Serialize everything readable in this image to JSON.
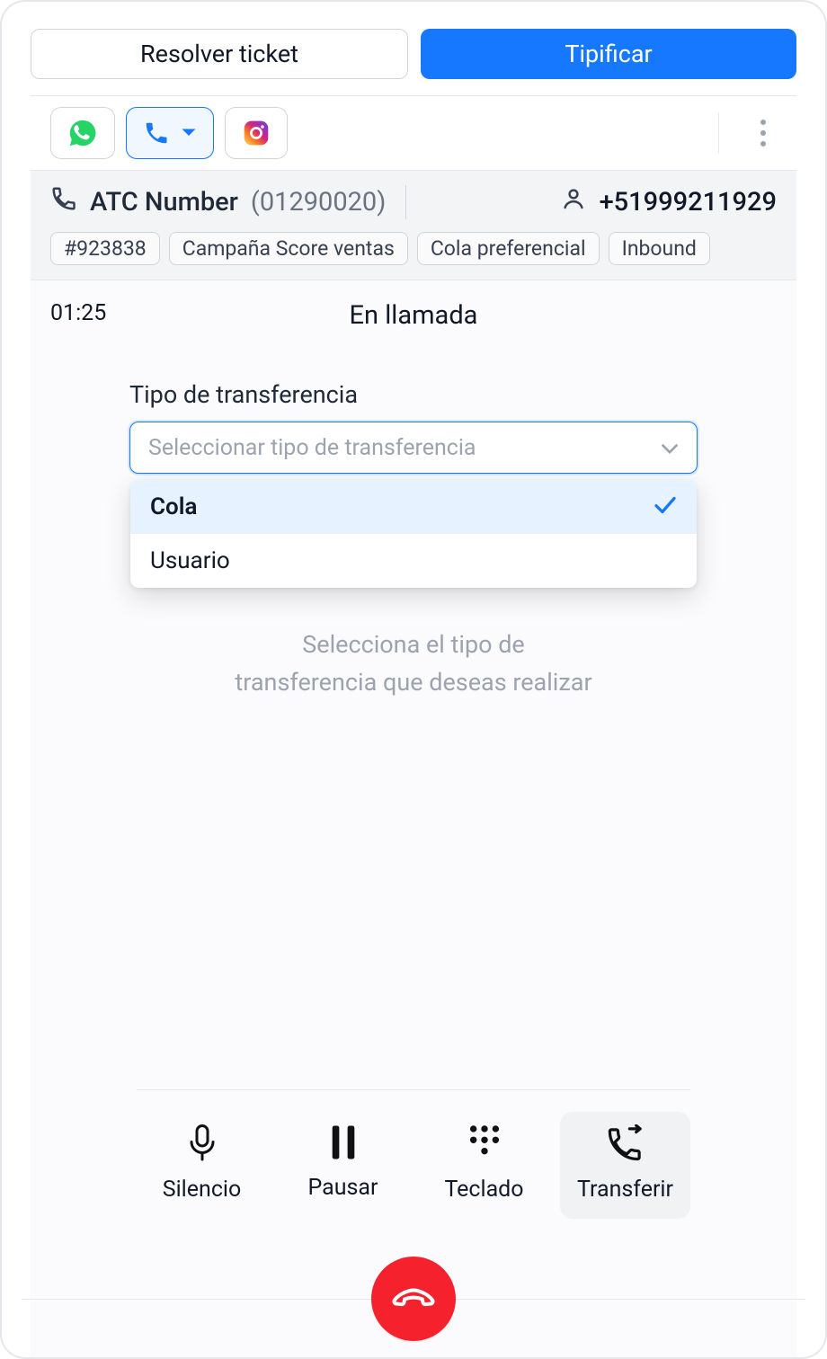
{
  "top_actions": {
    "resolve": "Resolver ticket",
    "typify": "Tipificar"
  },
  "channels": {
    "whatsapp": "whatsapp-icon",
    "phone": "phone-icon",
    "instagram": "instagram-icon"
  },
  "call_info": {
    "label": "ATC Number",
    "id_paren": "(01290020)",
    "phone": "+51999211929",
    "tags": [
      "#923838",
      "Campaña Score ventas",
      "Cola preferencial",
      "Inbound"
    ]
  },
  "call": {
    "timer": "01:25",
    "status": "En llamada"
  },
  "transfer": {
    "label": "Tipo de transferencia",
    "placeholder": "Seleccionar tipo de transferencia",
    "options": [
      {
        "label": "Cola",
        "selected": true
      },
      {
        "label": "Usuario",
        "selected": false
      }
    ],
    "hint_line1": "Selecciona el tipo de",
    "hint_line2": "transferencia que deseas realizar"
  },
  "controls": {
    "mute": "Silencio",
    "pause": "Pausar",
    "keypad": "Teclado",
    "transfer": "Transferir"
  }
}
